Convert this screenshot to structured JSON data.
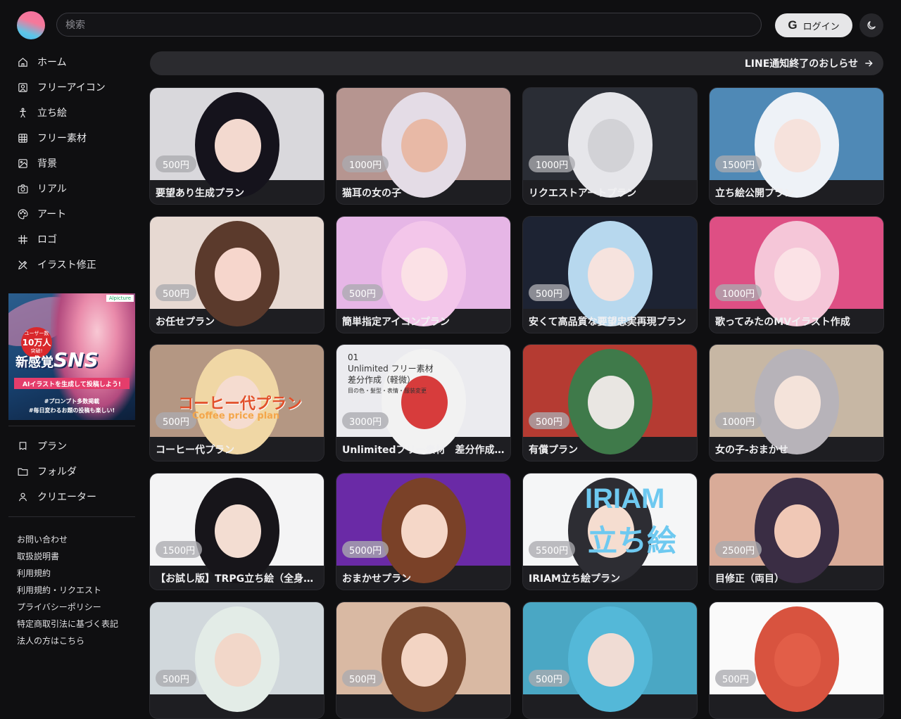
{
  "header": {
    "search_placeholder": "検索",
    "login_label": "ログイン",
    "login_icon": "google-g-icon",
    "theme_icon": "moon-icon"
  },
  "sidebar": {
    "nav": [
      {
        "label": "ホーム",
        "icon": "home-icon"
      },
      {
        "label": "フリーアイコン",
        "icon": "user-square-icon"
      },
      {
        "label": "立ち絵",
        "icon": "standing-figure-icon"
      },
      {
        "label": "フリー素材",
        "icon": "grid-icon"
      },
      {
        "label": "背景",
        "icon": "image-icon"
      },
      {
        "label": "リアル",
        "icon": "camera-icon"
      },
      {
        "label": "アート",
        "icon": "palette-icon"
      },
      {
        "label": "ロゴ",
        "icon": "hash-icon"
      },
      {
        "label": "イラスト修正",
        "icon": "pencil-ruler-icon"
      }
    ],
    "banner": {
      "brand": "Alpicture",
      "badge_top": "ユーザー数",
      "badge_num": "10万人",
      "badge_bottom": "突破!",
      "headline_small": "新感覚",
      "headline_big": "SNS",
      "strip": "AIイラストを生成して投稿しよう!",
      "line1": "#プロンプト多数掲載",
      "line2": "#毎日変わるお題の投稿も楽しい!"
    },
    "nav2": [
      {
        "label": "プラン",
        "icon": "plan-icon"
      },
      {
        "label": "フォルダ",
        "icon": "folder-icon"
      },
      {
        "label": "クリエーター",
        "icon": "person-icon"
      }
    ],
    "footer_links": [
      "お問い合わせ",
      "取扱説明書",
      "利用規約",
      "利用規約・リクエスト",
      "プライバシーポリシー",
      "特定商取引法に基づく表記",
      "法人の方はこちら"
    ]
  },
  "notice": {
    "text": "LINE通知終了のおしらせ",
    "icon": "arrow-right-icon"
  },
  "cards": [
    {
      "title": "要望あり生成プラン",
      "price": "500円",
      "bg": "#d9d8dc",
      "hair": "#15131c",
      "skin": "#f3d9cf"
    },
    {
      "title": "猫耳の女の子",
      "price": "1000円",
      "bg": "#b69590",
      "hair": "#e4dce6",
      "skin": "#e8b9a6"
    },
    {
      "title": "リクエストアートプラン",
      "price": "1000円",
      "bg": "#2a2d35",
      "hair": "#e6e6ea",
      "skin": "#d2d2d6"
    },
    {
      "title": "立ち絵公開プラン",
      "price": "1500円",
      "bg": "#4f89b6",
      "hair": "#eef2f7",
      "skin": "#f6e2dc"
    },
    {
      "title": "お任せプラン",
      "price": "500円",
      "bg": "#e7d9d2",
      "hair": "#5b3a2c",
      "skin": "#f6d6cc"
    },
    {
      "title": "簡単指定アイコンプラン",
      "price": "500円",
      "bg": "#e6b6e6",
      "hair": "#f3c6ea",
      "skin": "#fbe1e6"
    },
    {
      "title": "安くて高品質な要望忠実再現プラン",
      "price": "500円",
      "bg": "#1d2333",
      "hair": "#b7d8ee",
      "skin": "#f6e3de"
    },
    {
      "title": "歌ってみたのMVイラスト作成",
      "price": "1000円",
      "bg": "#de4f84",
      "hair": "#f5c6d8",
      "skin": "#fbe2e6"
    },
    {
      "title": "コーヒー代プラン",
      "price": "500円",
      "bg": "#b49783",
      "hair": "#f0d7a5",
      "skin": "#f5dcd0"
    },
    {
      "title": "Unlimitedフリー素材　差分作成（軽微）",
      "price": "3000円",
      "bg": "#ebebef",
      "hair": "#f2f2f2",
      "skin": "#d73c3c"
    },
    {
      "title": "有償プラン",
      "price": "500円",
      "bg": "#b53b32",
      "hair": "#3f7a4a",
      "skin": "#e9e6e2"
    },
    {
      "title": "女の子-おまかせ",
      "price": "1000円",
      "bg": "#c7b7a4",
      "hair": "#b7b3b9",
      "skin": "#f4e3da"
    },
    {
      "title": "【お試し版】TRPG立ち絵（全身）プラン",
      "price": "1500円",
      "bg": "#f4f4f5",
      "hair": "#17151a",
      "skin": "#f3ddd2"
    },
    {
      "title": "おまかせプラン",
      "price": "5000円",
      "bg": "#6a2aa6",
      "hair": "#7a4128",
      "skin": "#f5d7c8"
    },
    {
      "title": "IRIAM立ち絵プラン",
      "price": "5500円",
      "bg": "#f5f6f7",
      "hair": "#2d2d33",
      "skin": "#f5ddd0"
    },
    {
      "title": "目修正（両目）",
      "price": "2500円",
      "bg": "#d9ab98",
      "hair": "#3a2d44",
      "skin": "#f0c8b6"
    },
    {
      "title": "",
      "price": "500円",
      "bg": "#d1d8dc",
      "hair": "#e3ece7",
      "skin": "#f2d7c9"
    },
    {
      "title": "",
      "price": "500円",
      "bg": "#d9b9a3",
      "hair": "#7a4a30",
      "skin": "#f3d4c3"
    },
    {
      "title": "",
      "price": "500円",
      "bg": "#4aa7c4",
      "hair": "#54b8d8",
      "skin": "#f0dcd4"
    },
    {
      "title": "",
      "price": "500円",
      "bg": "#fafafa",
      "hair": "#d8533f",
      "skin": "#e25e48"
    }
  ],
  "card_special": {
    "iriam_text": "IRIAM",
    "iriam_sub": "立ち絵",
    "coffee_text": "コーヒー代プラン",
    "coffee_sub": "Coffee price plan",
    "unlimited_num": "01",
    "unlimited_line1": "Unlimited フリー素材",
    "unlimited_line2": "差分作成（軽微）",
    "unlimited_line3": "目の色・髪型・表情・服装変更"
  }
}
